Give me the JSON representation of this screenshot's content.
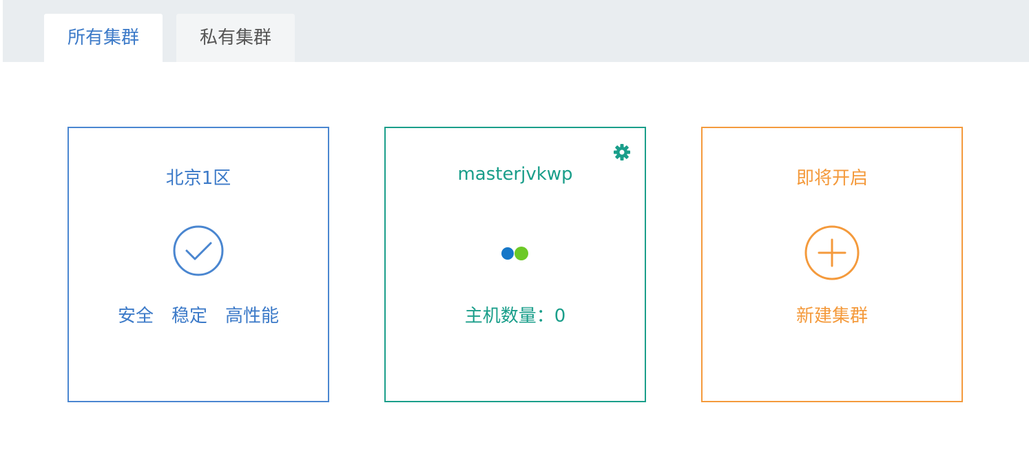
{
  "tabs": [
    {
      "label": "所有集群"
    },
    {
      "label": "私有集群"
    }
  ],
  "cards": {
    "region": {
      "title": "北京1区",
      "features": [
        "安全",
        "稳定",
        "高性能"
      ]
    },
    "cluster": {
      "name": "masterjvkwp",
      "host_count_label": "主机数量：",
      "host_count": "0"
    },
    "new_cluster": {
      "title": "即将开启",
      "action_label": "新建集群"
    }
  },
  "colors": {
    "blue": "#3c7ac8",
    "teal": "#1a9e8a",
    "orange": "#f49a3c",
    "dot_blue": "#1677c8",
    "dot_green": "#6cc926"
  },
  "icons": {
    "region": "check-circle-icon",
    "cluster_settings": "gear-icon",
    "cluster_status": "two-dots-icon",
    "new_cluster": "plus-circle-icon"
  }
}
